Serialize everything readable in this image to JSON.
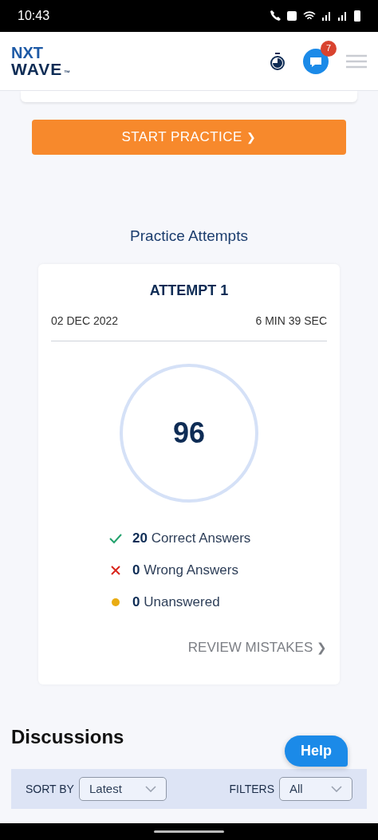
{
  "status_bar": {
    "time": "10:43"
  },
  "header": {
    "logo": {
      "line_1": "NXT",
      "line_2": "WAVE",
      "mark": "™"
    },
    "chat_badge": "7"
  },
  "start_button": {
    "label": "START PRACTICE",
    "icon": "❯"
  },
  "attempts_title": "Practice Attempts",
  "attempt": {
    "title": "ATTEMPT 1",
    "date": "02 DEC 2022",
    "duration": "6 MIN 39 SEC",
    "score": "96",
    "results": [
      {
        "kind": "correct",
        "count": "20",
        "label": "Correct Answers"
      },
      {
        "kind": "wrong",
        "count": "0",
        "label": "Wrong Answers"
      },
      {
        "kind": "unanswered",
        "count": "0",
        "label": "Unanswered"
      }
    ],
    "review_link": "REVIEW MISTAKES",
    "review_icon": "❯"
  },
  "discussions": {
    "title": "Discussions",
    "sort_label": "SORT BY",
    "sort_value": "Latest",
    "filter_label": "FILTERS",
    "filter_value": "All"
  },
  "help_button": "Help"
}
